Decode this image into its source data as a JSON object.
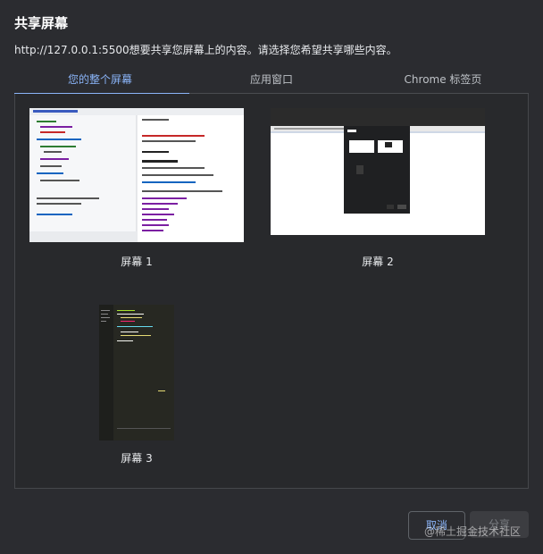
{
  "dialog": {
    "title": "共享屏幕",
    "subtitle": "http://127.0.0.1:5500想要共享您屏幕上的内容。请选择您希望共享哪些内容。"
  },
  "tabs": [
    {
      "label": "您的整个屏幕",
      "active": true
    },
    {
      "label": "应用窗口",
      "active": false
    },
    {
      "label": "Chrome 标签页",
      "active": false
    }
  ],
  "screens": [
    {
      "label": "屏幕 1"
    },
    {
      "label": "屏幕 2"
    },
    {
      "label": "屏幕 3"
    }
  ],
  "buttons": {
    "cancel": "取消",
    "share": "分享"
  },
  "watermark": "@稀土掘金技术社区",
  "colors": {
    "accent": "#8ab4f8",
    "background": "#2b2c30"
  }
}
